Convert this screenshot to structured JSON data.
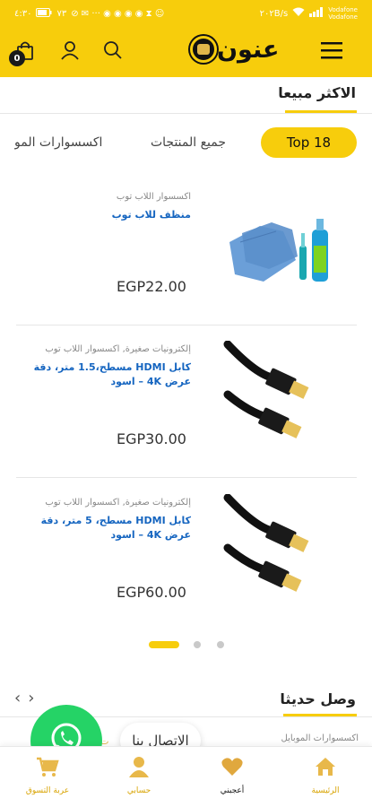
{
  "status_bar": {
    "time": "٤:٣٠",
    "battery": "٧٣",
    "speed": "٢٠٢B/s",
    "carrier_top": "Vodafone",
    "carrier_bottom": "Vodafone"
  },
  "header": {
    "menu_icon": "hamburger-menu-icon",
    "logo_text": "عنون",
    "search_icon": "search-icon",
    "account_icon": "user-icon",
    "cart_icon": "shopping-bag-icon",
    "cart_count": "0"
  },
  "best_sellers": {
    "title": "الاكثر مبيعا",
    "tabs": [
      {
        "label": "Top 18",
        "active": true
      },
      {
        "label": "جميع المنتجات",
        "active": false
      },
      {
        "label": "اكسسوارات المو",
        "active": false
      }
    ],
    "products": [
      {
        "category": "اكسسوار اللاب توب",
        "name": "منظف للاب توب",
        "price": "EGP22.00",
        "image": "laptop-cleaner-kit"
      },
      {
        "category": "إلكترونيات صغيرة, اكسسوار اللاب توب",
        "name": "كابل HDMI مسطح،1.5 متر، دقة عرض 4K – اسود",
        "price": "EGP30.00",
        "image": "hdmi-cable"
      },
      {
        "category": "إلكترونيات صغيرة, اكسسوار اللاب توب",
        "name": "كابل HDMI مسطح، 5 متر، دقة عرض 4K – اسود",
        "price": "EGP60.00",
        "image": "hdmi-cable"
      }
    ],
    "pagination": {
      "pages": 3,
      "active": 1
    }
  },
  "new_arrivals": {
    "title": "وصل حديثا",
    "prev_arrow": "chevron-left-icon",
    "next_arrow": "chevron-right-icon",
    "peek_category": "اكسسوارات الموبايل",
    "peek_left_text": "ت"
  },
  "contact": {
    "whatsapp_icon": "whatsapp-icon",
    "label": "الاتصال بنا"
  },
  "bottom_nav": [
    {
      "label": "الرئيسية",
      "icon": "home-icon"
    },
    {
      "label": "أعجبني",
      "icon": "heart-icon"
    },
    {
      "label": "حسابي",
      "icon": "user-icon"
    },
    {
      "label": "عربة التسوق",
      "icon": "cart-icon"
    }
  ],
  "colors": {
    "accent": "#f7cd0c",
    "link": "#1565c0",
    "whatsapp": "#25d366",
    "nav_label": "#d8a300"
  }
}
